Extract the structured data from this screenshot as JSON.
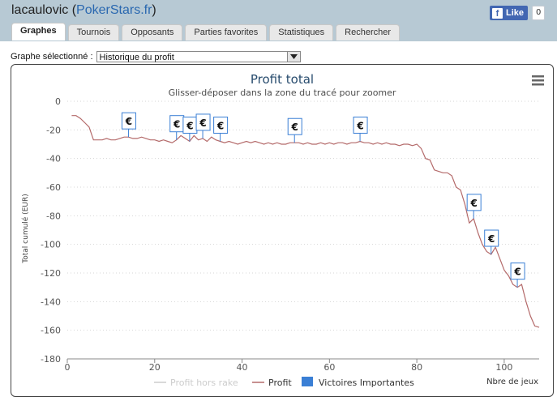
{
  "header": {
    "username": "lacaulovic",
    "site_open": " (",
    "site": "PokerStars.fr",
    "site_close": ")"
  },
  "facebook": {
    "like_label": "Like",
    "count": "0"
  },
  "tabs": [
    {
      "label": "Graphes",
      "active": true
    },
    {
      "label": "Tournois"
    },
    {
      "label": "Opposants"
    },
    {
      "label": "Parties favorites"
    },
    {
      "label": "Statistiques"
    },
    {
      "label": "Rechercher"
    }
  ],
  "selector": {
    "label": "Graphe sélectionné :",
    "value": "Historique du profit"
  },
  "menu_icon": "hamburger-menu-icon",
  "chart_data": {
    "type": "line",
    "title": "Profit total",
    "subtitle": "Glisser-déposer dans la zone du tracé pour zoomer",
    "ylabel": "Total cumulé (EUR)",
    "xlabel": "Nbre de jeux",
    "xlim": [
      0,
      108
    ],
    "ylim": [
      -180,
      0
    ],
    "x_ticks": [
      "0",
      "20",
      "40",
      "60",
      "80",
      "100"
    ],
    "y_ticks": [
      "0",
      "-20",
      "-40",
      "-60",
      "-80",
      "-100",
      "-120",
      "-140",
      "-160",
      "-180"
    ],
    "grid": "horizontal dotted",
    "legend_position": "bottom",
    "legend": [
      {
        "name": "Profit hors rake",
        "color": "#cccccc"
      },
      {
        "name": "Profit",
        "color": "#b46a6a"
      },
      {
        "name": "Victoires Importantes",
        "color": "#3a7fd5"
      }
    ],
    "series": [
      {
        "name": "Profit",
        "color": "#b46a6a",
        "points": [
          [
            1,
            -10
          ],
          [
            2,
            -10
          ],
          [
            3,
            -12
          ],
          [
            4,
            -15
          ],
          [
            5,
            -18
          ],
          [
            6,
            -27
          ],
          [
            7,
            -27
          ],
          [
            8,
            -27
          ],
          [
            9,
            -26
          ],
          [
            10,
            -27
          ],
          [
            11,
            -27
          ],
          [
            12,
            -26
          ],
          [
            13,
            -25
          ],
          [
            14,
            -25
          ],
          [
            15,
            -26
          ],
          [
            16,
            -26
          ],
          [
            17,
            -25
          ],
          [
            18,
            -26
          ],
          [
            19,
            -27
          ],
          [
            20,
            -27
          ],
          [
            21,
            -28
          ],
          [
            22,
            -27
          ],
          [
            23,
            -28
          ],
          [
            24,
            -29
          ],
          [
            25,
            -27
          ],
          [
            26,
            -24
          ],
          [
            27,
            -26
          ],
          [
            28,
            -28
          ],
          [
            29,
            -24
          ],
          [
            30,
            -27
          ],
          [
            31,
            -26
          ],
          [
            32,
            -28
          ],
          [
            33,
            -25
          ],
          [
            34,
            -27
          ],
          [
            35,
            -28
          ],
          [
            36,
            -29
          ],
          [
            37,
            -28
          ],
          [
            38,
            -29
          ],
          [
            39,
            -30
          ],
          [
            40,
            -29
          ],
          [
            41,
            -28
          ],
          [
            42,
            -29
          ],
          [
            43,
            -28
          ],
          [
            44,
            -29
          ],
          [
            45,
            -30
          ],
          [
            46,
            -29
          ],
          [
            47,
            -30
          ],
          [
            48,
            -29
          ],
          [
            49,
            -30
          ],
          [
            50,
            -30
          ],
          [
            51,
            -29
          ],
          [
            52,
            -29
          ],
          [
            53,
            -29
          ],
          [
            54,
            -30
          ],
          [
            55,
            -29
          ],
          [
            56,
            -30
          ],
          [
            57,
            -30
          ],
          [
            58,
            -29
          ],
          [
            59,
            -30
          ],
          [
            60,
            -29
          ],
          [
            61,
            -30
          ],
          [
            62,
            -29
          ],
          [
            63,
            -29
          ],
          [
            64,
            -30
          ],
          [
            65,
            -29
          ],
          [
            66,
            -29
          ],
          [
            67,
            -28
          ],
          [
            68,
            -29
          ],
          [
            69,
            -29
          ],
          [
            70,
            -30
          ],
          [
            71,
            -29
          ],
          [
            72,
            -30
          ],
          [
            73,
            -29
          ],
          [
            74,
            -30
          ],
          [
            75,
            -30
          ],
          [
            76,
            -31
          ],
          [
            77,
            -30
          ],
          [
            78,
            -30
          ],
          [
            79,
            -31
          ],
          [
            80,
            -30
          ],
          [
            81,
            -33
          ],
          [
            82,
            -40
          ],
          [
            83,
            -41
          ],
          [
            84,
            -48
          ],
          [
            85,
            -49
          ],
          [
            86,
            -50
          ],
          [
            87,
            -50
          ],
          [
            88,
            -52
          ],
          [
            89,
            -60
          ],
          [
            90,
            -62
          ],
          [
            91,
            -72
          ],
          [
            92,
            -85
          ],
          [
            93,
            -82
          ],
          [
            94,
            -92
          ],
          [
            95,
            -100
          ],
          [
            96,
            -105
          ],
          [
            97,
            -107
          ],
          [
            98,
            -102
          ],
          [
            99,
            -110
          ],
          [
            100,
            -118
          ],
          [
            101,
            -122
          ],
          [
            102,
            -128
          ],
          [
            103,
            -130
          ],
          [
            104,
            -128
          ],
          [
            105,
            -140
          ],
          [
            106,
            -150
          ],
          [
            107,
            -157
          ],
          [
            108,
            -158
          ]
        ]
      }
    ],
    "big_wins": [
      14,
      25,
      28,
      31,
      35,
      52,
      67,
      93,
      97,
      103
    ]
  }
}
